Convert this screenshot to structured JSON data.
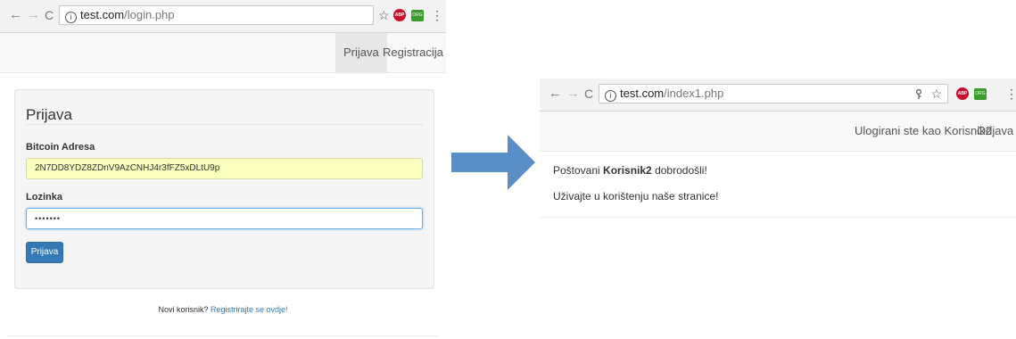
{
  "login_window": {
    "url_host": "test.com",
    "url_path": "/login.php",
    "nav": {
      "login": "Prijava",
      "register": "Registracija"
    },
    "form": {
      "title": "Prijava",
      "address_label": "Bitcoin Adresa",
      "address_value": "2N7DD8YDZ8ZDnV9AzCNHJ4r3fFZ5xDLtU9p",
      "password_label": "Lozinka",
      "password_value": "•••••••",
      "submit": "Prijava"
    },
    "footer": {
      "text": "Novi korisnik?",
      "link": "Registrirajte se ovdje!"
    }
  },
  "home_window": {
    "url_host": "test.com",
    "url_path": "/index1.php",
    "nav": {
      "logged_in": "Ulogirani ste kao Korisnik2",
      "logout": "Odjava"
    },
    "greeting": {
      "prefix": "Poštovani",
      "username": "Korisnik2",
      "suffix": "dobrodošli!"
    },
    "message": "Uživajte u korištenju naše stranice!"
  },
  "arrow_color": "#5b8fc7",
  "icons": {
    "back": "←",
    "forward": "→",
    "reload": "C",
    "info": "i",
    "star": "☆",
    "menu": "⋮",
    "pin": "key-icon",
    "adblock_text": "ABP",
    "ext_text": "ORG"
  }
}
